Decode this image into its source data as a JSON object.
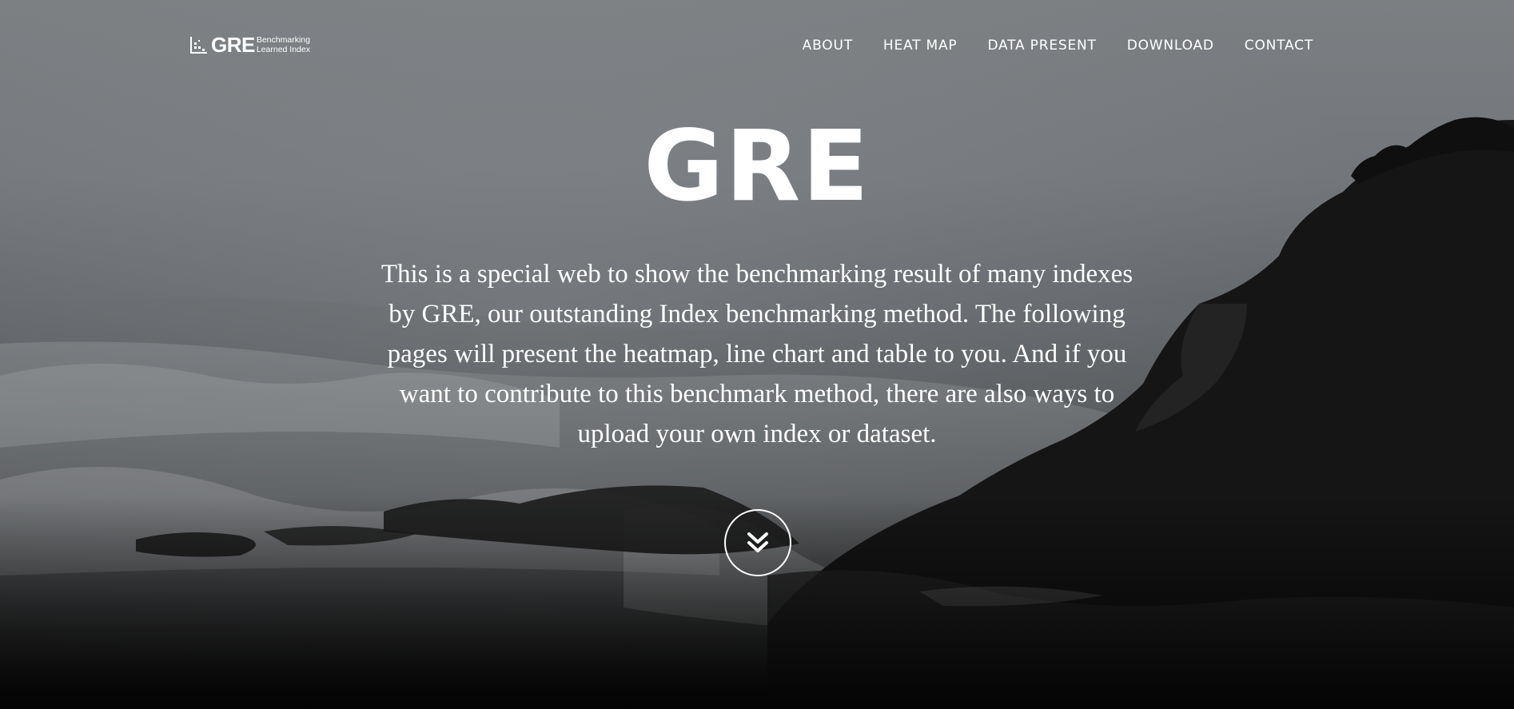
{
  "logo": {
    "name": "GRE",
    "sub_line1": "Benchmarking",
    "sub_line2": "Learned Index"
  },
  "nav": {
    "items": [
      {
        "label": "ABOUT"
      },
      {
        "label": "HEAT MAP"
      },
      {
        "label": "DATA PRESENT"
      },
      {
        "label": "DOWNLOAD"
      },
      {
        "label": "CONTACT"
      }
    ]
  },
  "hero": {
    "title": "GRE",
    "description": "This is a special web to show the benchmarking result of many indexes by GRE, our outstanding Index benchmarking method. The following pages will present the heatmap, line chart and table to you. And if you want to contribute to this benchmark method, there are also ways to upload your own index or dataset.",
    "background": "grayscale-coastline-photo",
    "scroll_icon": "double-chevron-down-icon"
  },
  "colors": {
    "text": "#ffffff",
    "sky": "#7c7f82",
    "rock": "#161616"
  }
}
